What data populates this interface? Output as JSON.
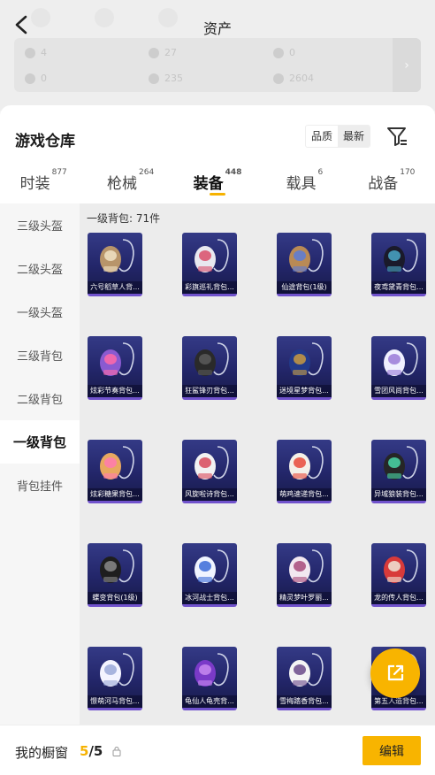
{
  "header": {
    "title": "资产",
    "assets": [
      {
        "icon": "gem-icon",
        "value": "4"
      },
      {
        "icon": "coin-icon",
        "value": "27"
      },
      {
        "icon": "token-icon",
        "value": "0"
      },
      {
        "icon": "crystal-icon",
        "value": "0"
      },
      {
        "icon": "ticket-icon",
        "value": "235"
      },
      {
        "icon": "voucher-icon",
        "value": "2604"
      }
    ]
  },
  "panel": {
    "title": "游戏仓库",
    "sort_options": [
      "品质",
      "最新"
    ],
    "active_sort": "最新"
  },
  "tabs": [
    {
      "label": "时装",
      "count": "877"
    },
    {
      "label": "枪械",
      "count": "264"
    },
    {
      "label": "装备",
      "count": "448",
      "active": true
    },
    {
      "label": "载具",
      "count": "6"
    },
    {
      "label": "战备",
      "count": "170"
    }
  ],
  "sidebar": {
    "items": [
      "三级头盔",
      "二级头盔",
      "一级头盔",
      "三级背包",
      "二级背包",
      "一级背包",
      "背包挂件"
    ],
    "active": "一级背包"
  },
  "content": {
    "section_label": "一级背包: 71件",
    "items": [
      {
        "name": "六号稻草人背...",
        "art": "scarecrow-bag",
        "c1": "#b8956a",
        "c2": "#f0e3c4"
      },
      {
        "name": "彩旗巡礼背包...",
        "art": "flag-bag",
        "c1": "#e8e8f0",
        "c2": "#d94d6a"
      },
      {
        "name": "仙途背包(1级)",
        "art": "charm-bag",
        "c1": "#b98a55",
        "c2": "#5a7bd9"
      },
      {
        "name": "夜鸢黛青背包...",
        "art": "dark-bag",
        "c1": "#1a1a2a",
        "c2": "#4aa8c8"
      },
      {
        "name": "炫彩节奏背包...",
        "art": "bottle-bag",
        "c1": "#8a5ad0",
        "c2": "#ff6aa8"
      },
      {
        "name": "狂鲨锋刃背包...",
        "art": "shark-bag",
        "c1": "#2a2a2a",
        "c2": "#5a5a5a"
      },
      {
        "name": "迷境星梦背包...",
        "art": "star-bag",
        "c1": "#223a8a",
        "c2": "#c89a40"
      },
      {
        "name": "雪团风尚背包...",
        "art": "bunny-bag",
        "c1": "#f0f0ff",
        "c2": "#9a7ad8"
      },
      {
        "name": "炫彩糖果背包...",
        "art": "donut-bag",
        "c1": "#e8a860",
        "c2": "#ff7ab0"
      },
      {
        "name": "风旋啦诗背包...",
        "art": "white-bag",
        "c1": "#f2f2f2",
        "c2": "#d84a5a"
      },
      {
        "name": "萌鸡速递背包...",
        "art": "chick-bag",
        "c1": "#f4f0e8",
        "c2": "#e84a3a"
      },
      {
        "name": "异域狼装背包...",
        "art": "case-bag",
        "c1": "#262626",
        "c2": "#4ad8a8"
      },
      {
        "name": "蝶变背包(1级)",
        "art": "butterfly-bag",
        "c1": "#1e1e1e",
        "c2": "#8a8a8a"
      },
      {
        "name": "冰河战士背包...",
        "art": "ice-bag",
        "c1": "#f0f4ff",
        "c2": "#3a6ad8"
      },
      {
        "name": "精灵梦叶罗丽...",
        "art": "fairy-bag",
        "c1": "#f2e8f0",
        "c2": "#a84a7a"
      },
      {
        "name": "龙的传人背包...",
        "art": "dragon-bag",
        "c1": "#d83a3a",
        "c2": "#f0e8d8"
      },
      {
        "name": "憬萌河马背包...",
        "art": "hippo-bag",
        "c1": "#f4f4ff",
        "c2": "#9aa8d8"
      },
      {
        "name": "龟仙人龟壳背...",
        "art": "shell-bag",
        "c1": "#7a3ac8",
        "c2": "#c88af0"
      },
      {
        "name": "雪梅踏香背包...",
        "art": "plum-bag",
        "c1": "#f4f4f4",
        "c2": "#6a4a8a"
      },
      {
        "name": "第五人造背包...",
        "art": "yellow-bag",
        "c1": "#e8b030",
        "c2": "#a83030"
      }
    ]
  },
  "fab": {
    "icon": "share-icon"
  },
  "bottom": {
    "label": "我的橱窗",
    "count_current": "5",
    "count_sep": "/",
    "count_total": "5",
    "edit_label": "编辑"
  },
  "colors": {
    "accent": "#f8b400",
    "card_bg": "#2a2d74",
    "card_border": "#7052cc"
  }
}
